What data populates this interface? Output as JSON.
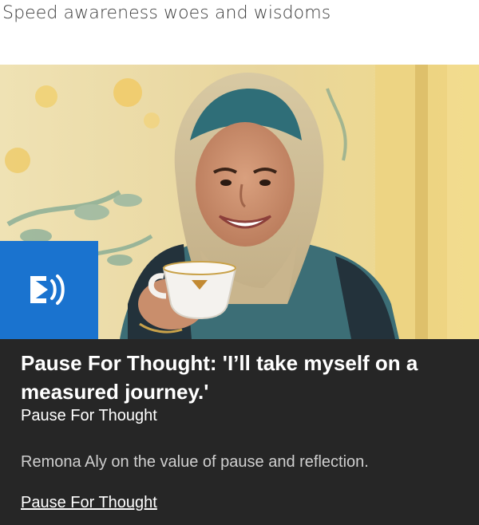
{
  "headline": "Speed awareness woes and wisdoms",
  "card": {
    "image": {
      "alt": "Remona Aly smiling in a headscarf, holding a teacup",
      "badge_icon": "audio-play-icon"
    },
    "title": "Pause For Thought: 'I’ll take myself on a measured journey.'",
    "brand": "Pause For Thought",
    "description": "Remona Aly on the value of pause and reflection.",
    "link_label": "Pause For Thought"
  },
  "colors": {
    "card_background": "#262626",
    "badge_blue": "#1a73cf",
    "headline_text": "#3c3c3c"
  }
}
